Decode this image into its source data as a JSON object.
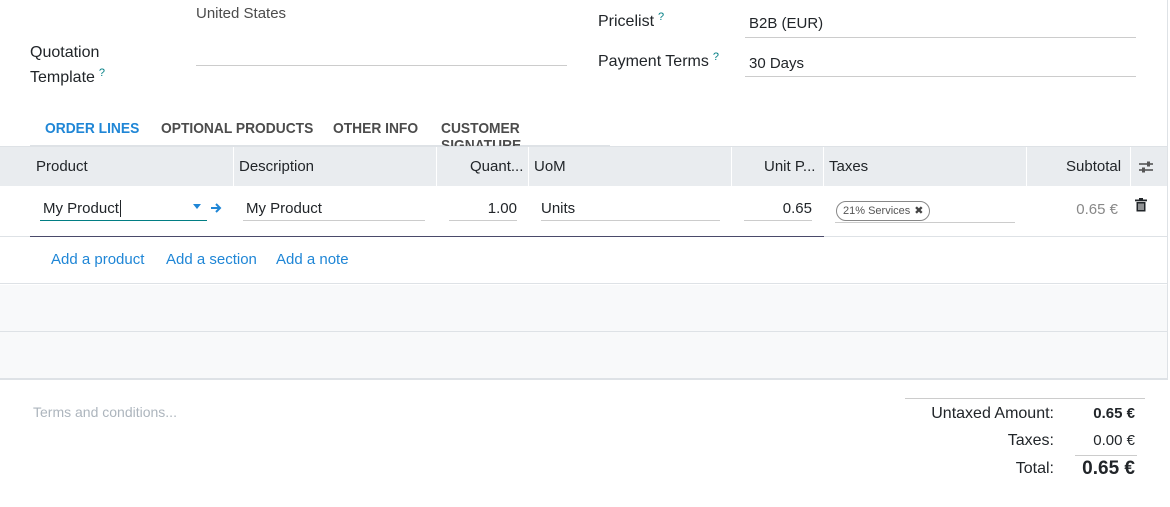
{
  "customer": {
    "country": "United States"
  },
  "quotation_template": {
    "label_line1": "Quotation",
    "label_line2": "Template",
    "help": "?"
  },
  "pricelist": {
    "label": "Pricelist",
    "help": "?",
    "value": "B2B (EUR)"
  },
  "payment_terms": {
    "label": "Payment Terms",
    "help": "?",
    "value": "30 Days"
  },
  "tabs": [
    {
      "label": "ORDER LINES",
      "active": true
    },
    {
      "label": "OPTIONAL PRODUCTS"
    },
    {
      "label": "OTHER INFO"
    },
    {
      "label": "CUSTOMER SIGNATURE"
    }
  ],
  "columns": {
    "product": "Product",
    "description": "Description",
    "quantity": "Quant...",
    "uom": "UoM",
    "unit_price": "Unit P...",
    "taxes": "Taxes",
    "subtotal": "Subtotal"
  },
  "line": {
    "product": "My Product",
    "description": "My Product",
    "quantity": "1.00",
    "uom": "Units",
    "unit_price": "0.65",
    "tax_tag": "21% Services",
    "subtotal": "0.65 €"
  },
  "add_links": {
    "product": "Add a product",
    "section": "Add a section",
    "note": "Add a note"
  },
  "terms_placeholder": "Terms and conditions...",
  "totals": {
    "untaxed_label": "Untaxed Amount:",
    "untaxed_value": "0.65 €",
    "taxes_label": "Taxes:",
    "taxes_value": "0.00 €",
    "total_label": "Total:",
    "total_value": "0.65 €"
  },
  "colors": {
    "accent": "#1f86d6",
    "help": "#017e84",
    "header_bg": "#e9ecef"
  },
  "icons": {
    "dropdown": "caret-down-icon",
    "external": "arrow-right-icon",
    "delete": "trash-icon",
    "columns": "sliders-icon"
  }
}
